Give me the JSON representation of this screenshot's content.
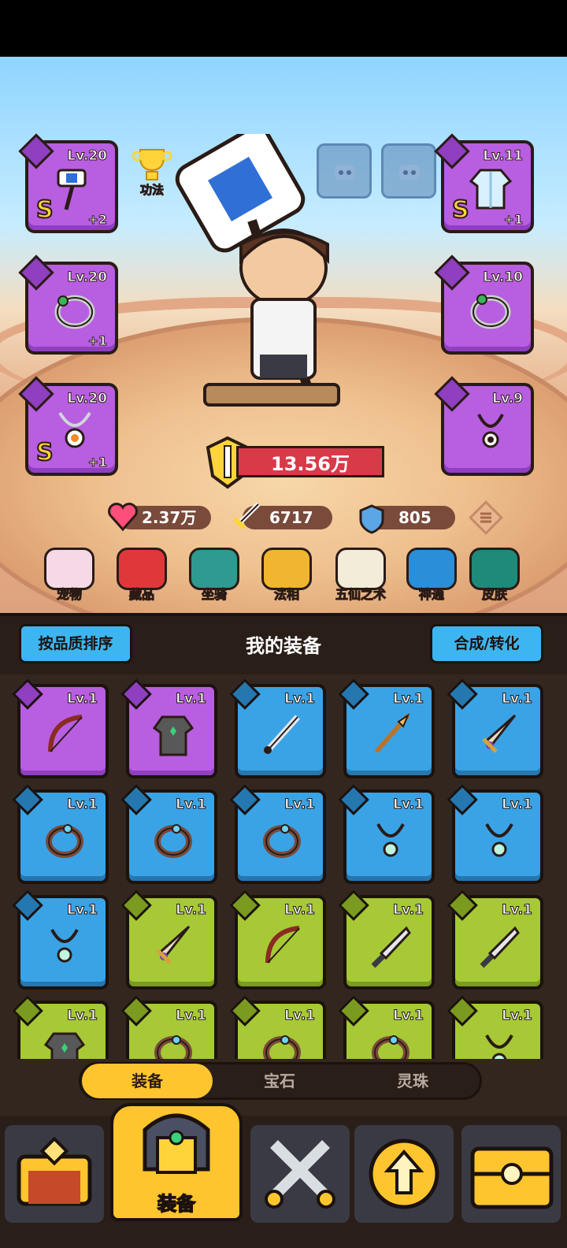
{
  "hero": {
    "skill_label": "功法",
    "power_value": "13.56万",
    "stats": {
      "hp": "2.37万",
      "attack": "6717",
      "defense": "805"
    }
  },
  "equipped": [
    {
      "slot": "weapon",
      "level": "Lv.20",
      "grade": "S",
      "bonus": "+2",
      "icon": "hammer-icon"
    },
    {
      "slot": "ring-left",
      "level": "Lv.20",
      "grade": "",
      "bonus": "+1",
      "icon": "ring-icon"
    },
    {
      "slot": "amulet-left",
      "level": "Lv.20",
      "grade": "S",
      "bonus": "+1",
      "icon": "amulet-icon"
    },
    {
      "slot": "armor",
      "level": "Lv.11",
      "grade": "S",
      "bonus": "+1",
      "icon": "robe-icon"
    },
    {
      "slot": "ring-right",
      "level": "Lv.10",
      "grade": "",
      "bonus": "",
      "icon": "ring-icon"
    },
    {
      "slot": "amulet-right",
      "level": "Lv.9",
      "grade": "",
      "bonus": "",
      "icon": "amulet-icon"
    }
  ],
  "features": [
    "宠物",
    "藏品",
    "坐骑",
    "法相",
    "五仙之术",
    "神通",
    "皮肤"
  ],
  "inventory": {
    "sort_button": "按品质排序",
    "title": "我的装备",
    "merge_button": "合成/转化",
    "items": [
      {
        "level": "Lv.1",
        "rarity": "purple",
        "icon": "bow-icon"
      },
      {
        "level": "Lv.1",
        "rarity": "purple",
        "icon": "robe-icon"
      },
      {
        "level": "Lv.1",
        "rarity": "blue",
        "icon": "sword-icon"
      },
      {
        "level": "Lv.1",
        "rarity": "blue",
        "icon": "spear-icon"
      },
      {
        "level": "Lv.1",
        "rarity": "blue",
        "icon": "broadsword-icon"
      },
      {
        "level": "Lv.1",
        "rarity": "blue",
        "icon": "ring-icon"
      },
      {
        "level": "Lv.1",
        "rarity": "blue",
        "icon": "ring-icon"
      },
      {
        "level": "Lv.1",
        "rarity": "blue",
        "icon": "ring-icon"
      },
      {
        "level": "Lv.1",
        "rarity": "blue",
        "icon": "amulet-icon"
      },
      {
        "level": "Lv.1",
        "rarity": "blue",
        "icon": "amulet-icon"
      },
      {
        "level": "Lv.1",
        "rarity": "blue",
        "icon": "amulet-icon"
      },
      {
        "level": "Lv.1",
        "rarity": "green",
        "icon": "broadsword-icon"
      },
      {
        "level": "Lv.1",
        "rarity": "green",
        "icon": "bow-icon"
      },
      {
        "level": "Lv.1",
        "rarity": "green",
        "icon": "knife-icon"
      },
      {
        "level": "Lv.1",
        "rarity": "green",
        "icon": "knife-icon"
      },
      {
        "level": "Lv.1",
        "rarity": "green",
        "icon": "robe-icon"
      },
      {
        "level": "Lv.1",
        "rarity": "green",
        "icon": "ring-icon"
      },
      {
        "level": "Lv.1",
        "rarity": "green",
        "icon": "ring-icon"
      },
      {
        "level": "Lv.1",
        "rarity": "green",
        "icon": "ring-icon"
      },
      {
        "level": "Lv.1",
        "rarity": "green",
        "icon": "amulet-icon"
      }
    ]
  },
  "tabs": [
    {
      "label": "装备",
      "active": true
    },
    {
      "label": "宝石",
      "active": false
    },
    {
      "label": "灵珠",
      "active": false
    }
  ],
  "nav": {
    "active_label": "装备"
  },
  "colors": {
    "purple": "#b85ee0",
    "blue": "#3aa3e6",
    "green": "#a6c935",
    "accent": "#ffc52e"
  }
}
